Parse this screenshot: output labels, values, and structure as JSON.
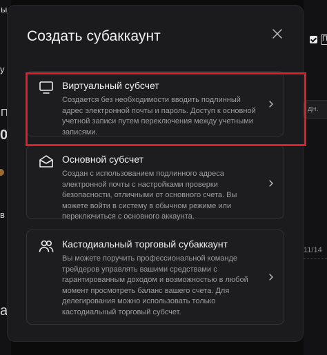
{
  "modal": {
    "title": "Создать субаккаунт",
    "options": [
      {
        "icon": "monitor-icon",
        "title": "Виртуальный субсчет",
        "description": "Создается без необходимости вводить подлинный адрес электронной почты и пароль. Доступ к основной учетной записи путем переключения между учетными записями."
      },
      {
        "icon": "envelope-icon",
        "title": "Основной субсчет",
        "description": "Создан с использованием подлинного адреса электронной почты с настройками проверки безопасности, отличными от основного счета. Вы можете войти в систему в обычном режиме или переключиться с основного аккаунта."
      },
      {
        "icon": "users-icon",
        "title": "Кастодиальный торговый субаккаунт",
        "description": "Вы можете поручить профессиональной команде трейдеров управлять вашими средствами с гарантированным доходом и возможностью в любой момент просмотреть баланс вашего счета. Для делегирования можно использовать только кастодиальный торговый субсчет."
      }
    ]
  },
  "background": {
    "left_fragments": [
      "ы",
      "у",
      "П",
      "0",
      "в",
      "а"
    ],
    "right_check_letter": "П",
    "right_pill_text": "дн.",
    "right_date": "11/14"
  },
  "colors": {
    "modal_bg": "#1b1b1d",
    "card_border": "#333337",
    "highlight": "#e01e2a",
    "title_text": "#f2f2f2",
    "desc_text": "#9c9ca1"
  }
}
